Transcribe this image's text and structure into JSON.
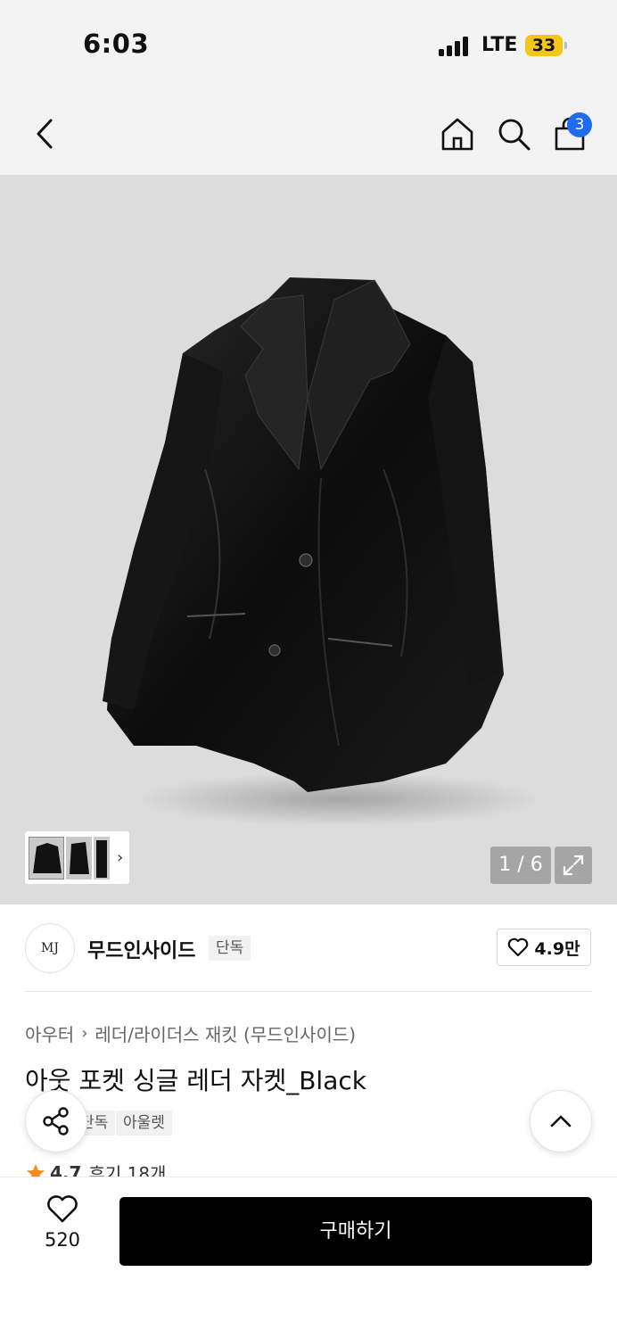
{
  "status_bar": {
    "time": "6:03",
    "network": "LTE",
    "battery": "33",
    "battery_color": "#f5c518"
  },
  "nav": {
    "back_icon": "chevron-left-icon",
    "home_icon": "home-icon",
    "search_icon": "search-icon",
    "cart_icon": "shopping-bag-icon",
    "cart_badge": "3",
    "badge_color": "#1f6bf1"
  },
  "gallery": {
    "counter": "1 / 6",
    "expand_icon": "expand-icon",
    "thumbs_chevron": "›"
  },
  "brand": {
    "logo_text": "MJ",
    "name": "무드인사이드",
    "tag": "단독",
    "likes": "4.9만"
  },
  "breadcrumb": {
    "category": "아우터",
    "separator": "›",
    "subcategory": "레더/라이더스 재킷 (무드인사이드)"
  },
  "product": {
    "title": "아웃 포켓 싱글 레더 자켓_Black",
    "tags": [
      "단독",
      "아울렛"
    ],
    "rating": "4.7",
    "reviews": "후기 18개"
  },
  "bottom_bar": {
    "wish_count": "520",
    "buy_label": "구매하기"
  }
}
